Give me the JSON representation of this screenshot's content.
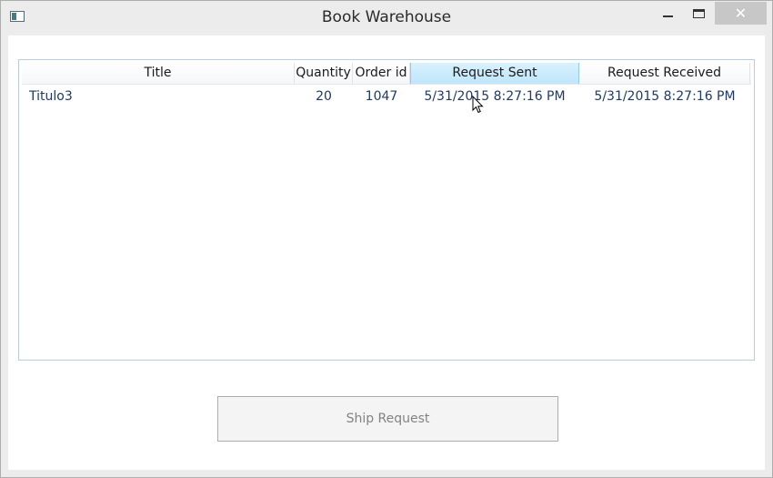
{
  "window": {
    "title": "Book Warehouse",
    "close_glyph": "✕"
  },
  "table": {
    "columns": [
      "Title",
      "Quantity",
      "Order id",
      "Request Sent",
      "Request Received"
    ],
    "rows": [
      {
        "title": "Titulo3",
        "quantity": "20",
        "order_id": "1047",
        "request_sent": "5/31/2015 8:27:16 PM",
        "request_received": "5/31/2015 8:27:16 PM"
      }
    ],
    "hovered_column": "Request Sent"
  },
  "actions": {
    "ship_label": "Ship Request",
    "ship_enabled": false
  },
  "icons": {
    "app": "window-app-icon",
    "minimize": "minimize-icon",
    "maximize": "maximize-icon",
    "close": "close-icon",
    "cursor": "mouse-pointer-icon"
  },
  "colors": {
    "header_hover": "#bfe6fb",
    "row_text": "#1f3a66",
    "close_button_bg": "#c7c7c7"
  }
}
